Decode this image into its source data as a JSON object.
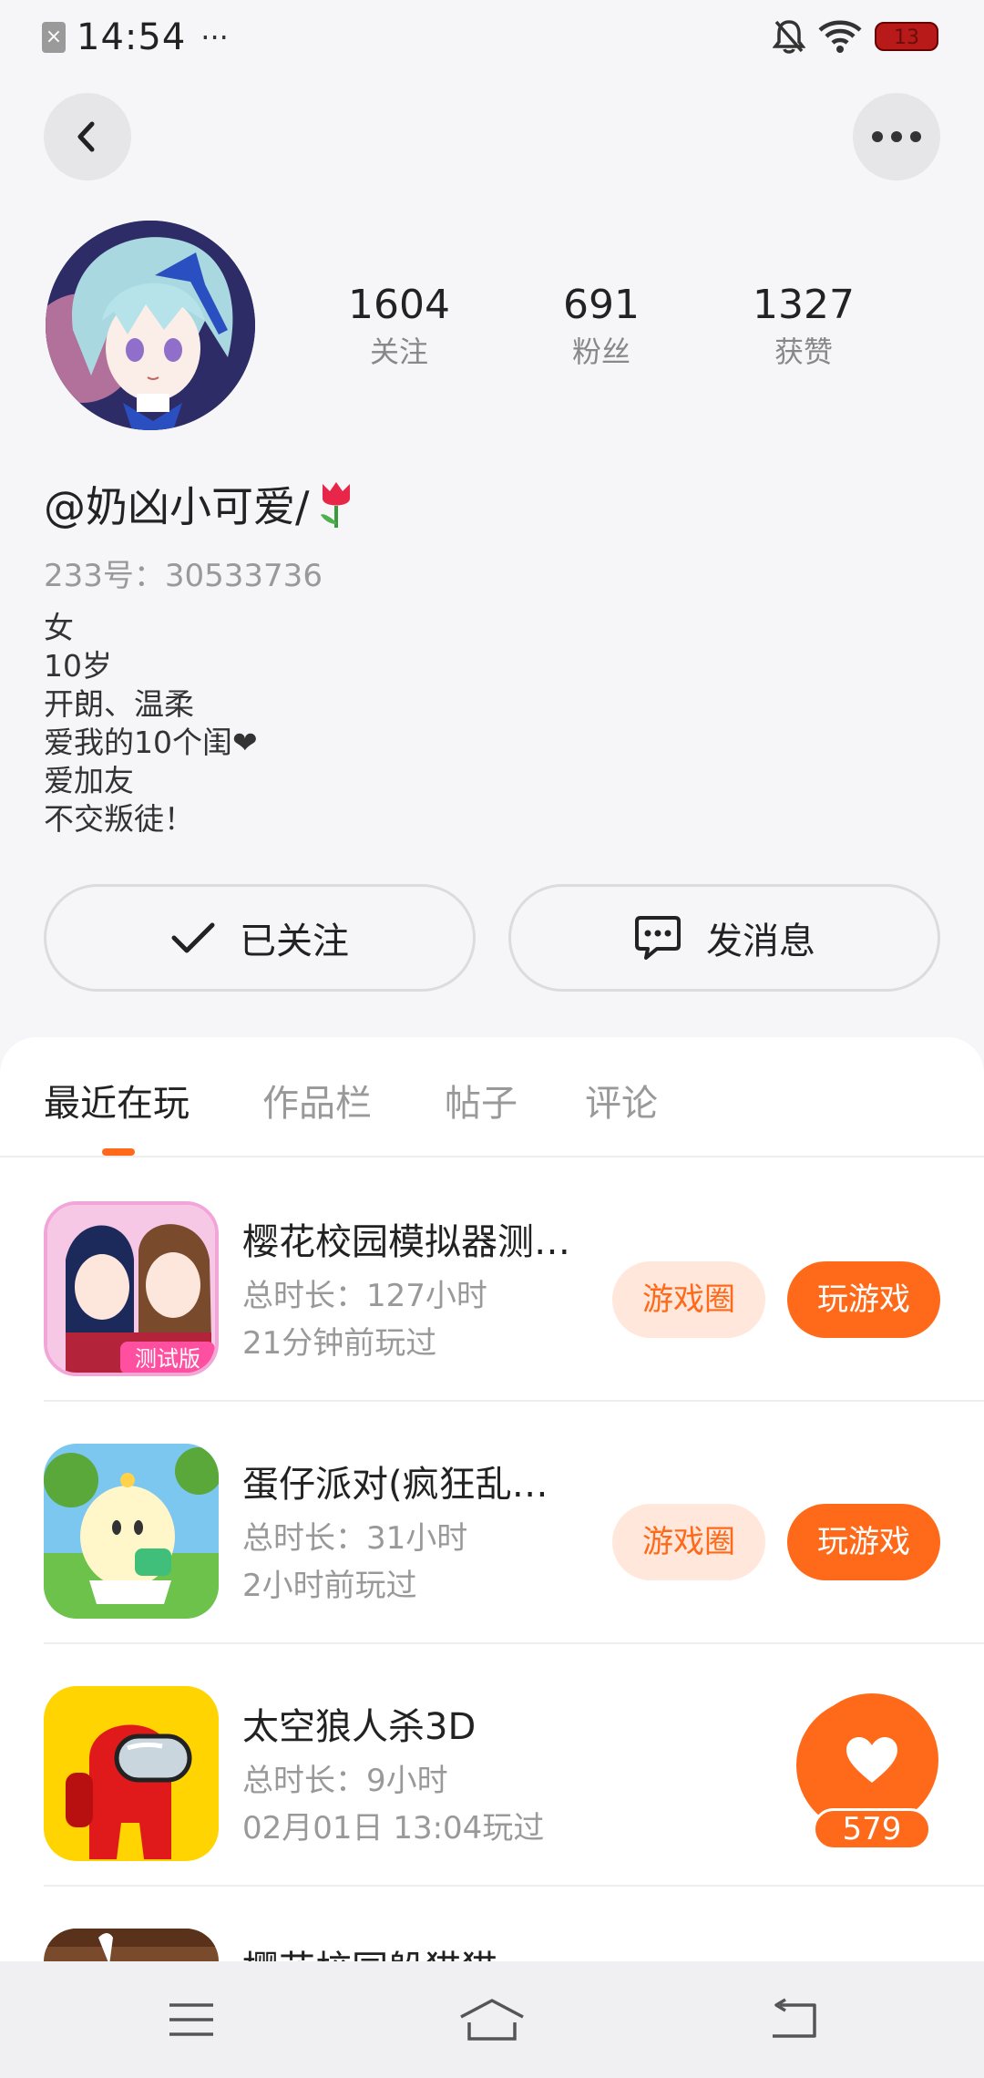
{
  "status_bar": {
    "time": "14:54",
    "dots": "···",
    "battery": "13"
  },
  "profile": {
    "stats": [
      {
        "value": "1604",
        "label": "关注"
      },
      {
        "value": "691",
        "label": "粉丝"
      },
      {
        "value": "1327",
        "label": "获赞"
      }
    ],
    "nickname": "@奶凶小可爱/",
    "id_line": "233号：30533736",
    "bio": [
      "女",
      "10岁",
      "开朗、温柔",
      "爱我的10个闺❤",
      "爱加友",
      "不交叛徒！"
    ]
  },
  "actions": {
    "follow_label": "已关注",
    "message_label": "发消息"
  },
  "tabs": [
    {
      "label": "最近在玩"
    },
    {
      "label": "作品栏"
    },
    {
      "label": "帖子"
    },
    {
      "label": "评论"
    }
  ],
  "games": [
    {
      "title": "樱花校园模拟器测…",
      "duration": "总时长：127小时",
      "last_played": "21分钟前玩过",
      "circle_label": "游戏圈",
      "play_label": "玩游戏"
    },
    {
      "title": "蛋仔派对(疯狂乱…",
      "duration": "总时长：31小时",
      "last_played": "2小时前玩过",
      "circle_label": "游戏圈",
      "play_label": "玩游戏"
    },
    {
      "title": "太空狼人杀3D",
      "duration": "总时长：9小时",
      "last_played": "02月01日 13:04玩过"
    },
    {
      "title": "樱花校园躲猫猫"
    }
  ],
  "like_button": {
    "count": "579"
  },
  "colors": {
    "accent": "#ff6a1a",
    "accent_light": "#ffe7db",
    "background": "#f6f6f8"
  },
  "icons": [
    "back-arrow-icon",
    "more-dots-icon",
    "check-icon",
    "chat-bubble-icon",
    "heart-icon",
    "menu-icon",
    "home-icon",
    "return-icon"
  ]
}
